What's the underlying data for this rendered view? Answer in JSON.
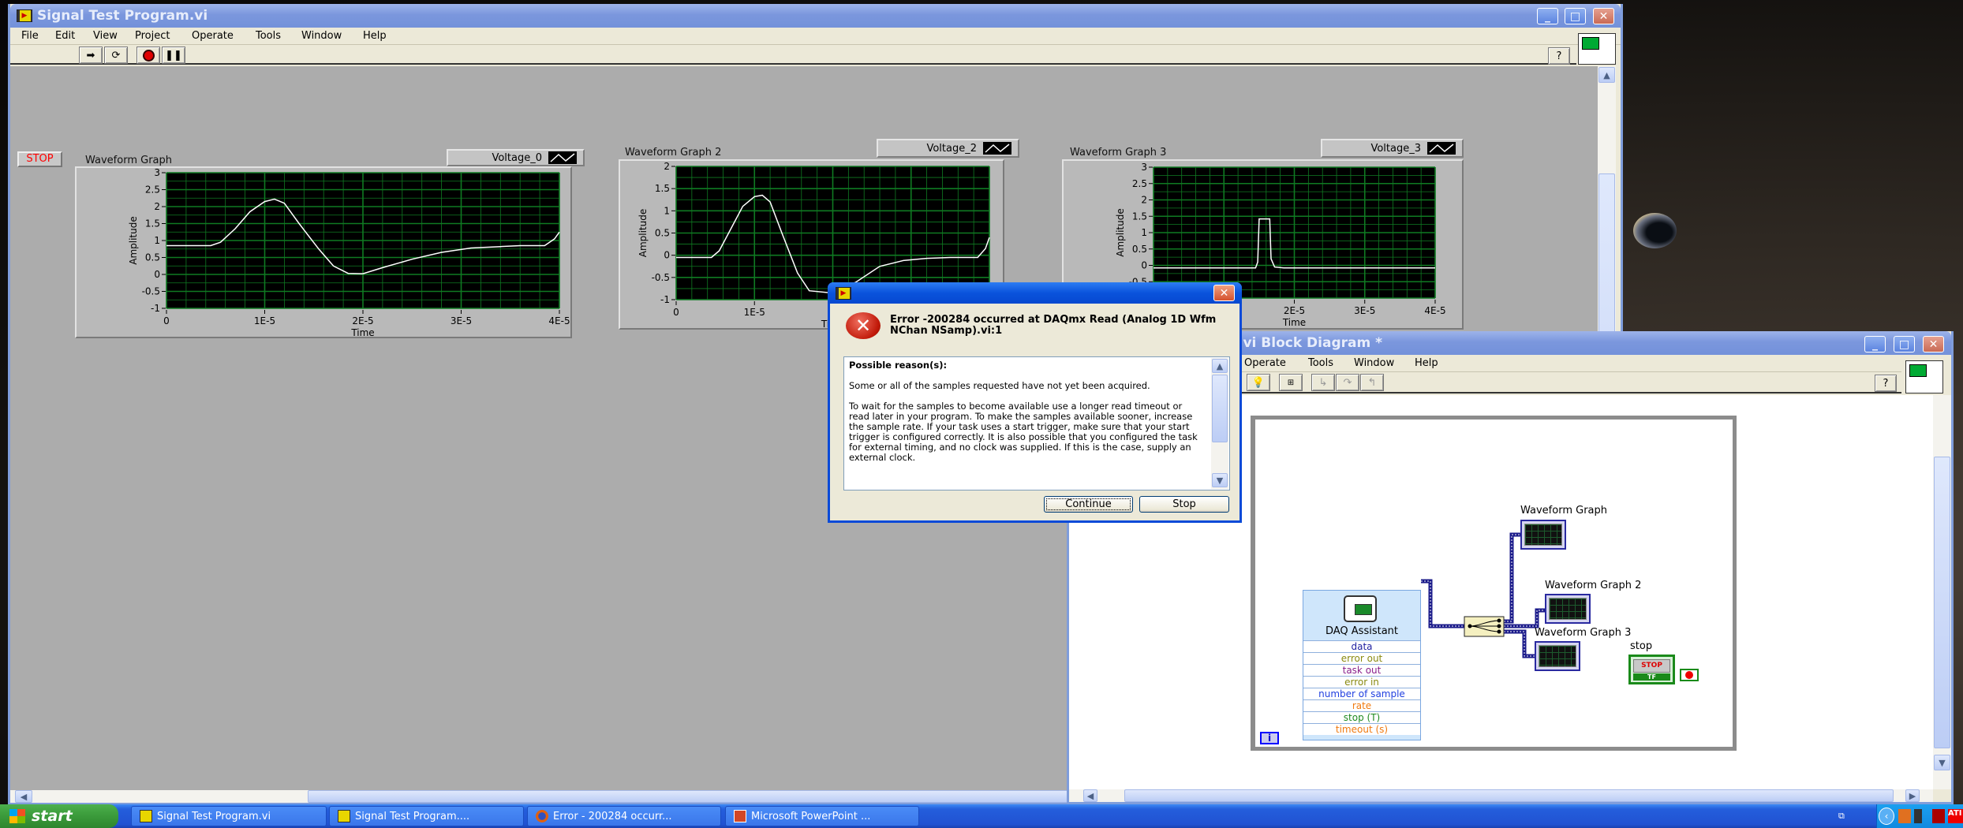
{
  "front_panel": {
    "title": "Signal Test Program.vi",
    "menu": [
      "File",
      "Edit",
      "View",
      "Project",
      "Operate",
      "Tools",
      "Window",
      "Help"
    ],
    "toolbar": {
      "run": "run-arrow",
      "run_continuously": "run-continuously",
      "abort": "abort-execution",
      "pause": "pause"
    },
    "stop_button": "STOP",
    "graphs": [
      {
        "label": "Waveform Graph",
        "legend": "Voltage_0"
      },
      {
        "label": "Waveform Graph 2",
        "legend": "Voltage_2"
      },
      {
        "label": "Waveform Graph 3",
        "legend": "Voltage_3"
      }
    ]
  },
  "chart_data": [
    {
      "type": "line",
      "title": "Waveform Graph",
      "xlabel": "Time",
      "ylabel": "Amplitude",
      "series": [
        {
          "name": "Voltage_0",
          "color": "#ffffff",
          "x": [
            0,
            4.5e-06,
            5.5e-06,
            7e-06,
            8.5e-06,
            1e-05,
            1.1e-05,
            1.2e-05,
            1.35e-05,
            1.55e-05,
            1.7e-05,
            1.85e-05,
            2e-05,
            2.2e-05,
            2.5e-05,
            2.8e-05,
            3.1e-05,
            3.4e-05,
            3.6e-05,
            3.85e-05,
            3.95e-05,
            4e-05
          ],
          "y": [
            0.85,
            0.85,
            0.95,
            1.35,
            1.85,
            2.15,
            2.22,
            2.1,
            1.5,
            0.75,
            0.25,
            0.03,
            0.02,
            0.2,
            0.45,
            0.65,
            0.78,
            0.82,
            0.85,
            0.85,
            1.05,
            1.25
          ]
        }
      ],
      "xlim": [
        0,
        4e-05
      ],
      "ylim": [
        -1,
        3
      ],
      "xticks": [
        {
          "v": 0,
          "label": "0"
        },
        {
          "v": 1e-05,
          "label": "1E-5"
        },
        {
          "v": 2e-05,
          "label": "2E-5"
        },
        {
          "v": 3e-05,
          "label": "3E-5"
        },
        {
          "v": 4e-05,
          "label": "4E-5"
        }
      ],
      "yticks": [
        {
          "v": 3,
          "label": "3"
        },
        {
          "v": 2.5,
          "label": "2.5"
        },
        {
          "v": 2,
          "label": "2"
        },
        {
          "v": 1.5,
          "label": "1.5"
        },
        {
          "v": 1,
          "label": "1"
        },
        {
          "v": 0.5,
          "label": "0.5"
        },
        {
          "v": 0,
          "label": "0"
        },
        {
          "v": -0.5,
          "label": "-0.5"
        },
        {
          "v": -1,
          "label": "-1"
        }
      ],
      "grid": true,
      "background": "#000000",
      "grid_color": "#0f7a22"
    },
    {
      "type": "line",
      "title": "Waveform Graph 2",
      "xlabel": "Time",
      "ylabel": "Amplitude",
      "series": [
        {
          "name": "Voltage_2",
          "color": "#ffffff",
          "x": [
            0,
            4.5e-06,
            5.5e-06,
            7e-06,
            8.5e-06,
            1e-05,
            1.1e-05,
            1.2e-05,
            1.35e-05,
            1.55e-05,
            1.7e-05,
            2e-05,
            2.3e-05,
            2.6e-05,
            2.9e-05,
            3.2e-05,
            3.5e-05,
            3.85e-05,
            3.95e-05,
            4e-05
          ],
          "y": [
            -0.05,
            -0.05,
            0.1,
            0.6,
            1.1,
            1.32,
            1.35,
            1.2,
            0.5,
            -0.4,
            -0.8,
            -0.85,
            -0.6,
            -0.25,
            -0.12,
            -0.07,
            -0.05,
            -0.05,
            0.15,
            0.4
          ]
        }
      ],
      "xlim": [
        0,
        4e-05
      ],
      "ylim": [
        -1,
        2
      ],
      "xticks": [
        {
          "v": 0,
          "label": "0"
        },
        {
          "v": 1e-05,
          "label": "1E-5"
        }
      ],
      "yticks": [
        {
          "v": 2,
          "label": "2"
        },
        {
          "v": 1.5,
          "label": "1.5"
        },
        {
          "v": 1,
          "label": "1"
        },
        {
          "v": 0.5,
          "label": "0.5"
        },
        {
          "v": 0,
          "label": "0"
        },
        {
          "v": -0.5,
          "label": "-0.5"
        },
        {
          "v": -1,
          "label": "-1"
        }
      ],
      "grid": true,
      "background": "#000000",
      "grid_color": "#0f7a22"
    },
    {
      "type": "line",
      "title": "Waveform Graph 3",
      "xlabel": "Time",
      "ylabel": "Amplitude",
      "series": [
        {
          "name": "Voltage_3",
          "color": "#ffffff",
          "x": [
            0,
            1.45e-05,
            1.48e-05,
            1.5e-05,
            1.65e-05,
            1.67e-05,
            1.72e-05,
            1.85e-05,
            4e-05
          ],
          "y": [
            -0.08,
            -0.08,
            0.1,
            1.42,
            1.42,
            0.2,
            -0.05,
            -0.08,
            -0.08
          ]
        }
      ],
      "xlim": [
        0,
        4e-05
      ],
      "ylim": [
        -1,
        3
      ],
      "xticks": [
        {
          "v": 2e-05,
          "label": "2E-5"
        },
        {
          "v": 3e-05,
          "label": "3E-5"
        },
        {
          "v": 4e-05,
          "label": "4E-5"
        }
      ],
      "yticks": [
        {
          "v": 3,
          "label": "3"
        },
        {
          "v": 2.5,
          "label": "2.5"
        },
        {
          "v": 2,
          "label": "2"
        },
        {
          "v": 1.5,
          "label": "1.5"
        },
        {
          "v": 1,
          "label": "1"
        },
        {
          "v": 0.5,
          "label": "0.5"
        },
        {
          "v": 0,
          "label": "0"
        },
        {
          "v": -0.5,
          "label": "-0.5"
        }
      ],
      "grid": true,
      "background": "#000000",
      "grid_color": "#0f7a22"
    }
  ],
  "dialog": {
    "heading": "Error -200284 occurred at DAQmx Read (Analog 1D Wfm NChan NSamp).vi:1",
    "reason_title": "Possible reason(s):",
    "paragraph1": "Some or all of the samples requested have not yet been acquired.",
    "paragraph2": "To wait for the samples to become available use a longer read timeout or read later in your program. To make the samples available sooner, increase the sample rate. If your task uses a start trigger,  make sure that your start trigger is configured correctly. It is also possible that you configured the task for external timing, and no clock was supplied. If this is the case, supply an external clock.",
    "continue": "Continue",
    "stop": "Stop"
  },
  "block_diagram": {
    "title": ".vi Block Diagram *",
    "menu": [
      "Operate",
      "Tools",
      "Window",
      "Help"
    ],
    "daq_assistant": {
      "title": "DAQ Assistant",
      "terminals": [
        {
          "label": "data",
          "color": "#1f1fa0"
        },
        {
          "label": "error out",
          "color": "#8a8a10"
        },
        {
          "label": "task out",
          "color": "#8a1f8a"
        },
        {
          "label": "error in",
          "color": "#8a8a10"
        },
        {
          "label": "number of sample",
          "color": "#1f3fe0"
        },
        {
          "label": "rate",
          "color": "#f07a10"
        },
        {
          "label": "stop (T)",
          "color": "#1f8a1f"
        },
        {
          "label": "timeout (s)",
          "color": "#f07a10"
        }
      ]
    },
    "terminals": [
      "Waveform Graph",
      "Waveform Graph 2",
      "Waveform Graph 3"
    ],
    "stop_label": "stop",
    "stop_button": "STOP",
    "stop_tf": "TF",
    "info": "i"
  },
  "taskbar": {
    "start": "start",
    "items": [
      {
        "label": "Signal Test Program.vi",
        "icon": "labview-icon"
      },
      {
        "label": "Signal Test Program....",
        "icon": "labview-icon"
      },
      {
        "label": "Error - 200284 occurr...",
        "icon": "firefox-icon"
      },
      {
        "label": "Microsoft PowerPoint ...",
        "icon": "powerpoint-icon"
      }
    ]
  },
  "colors": {
    "title_active": "#0a53dc",
    "title_inactive": "#7b97dd",
    "panel_bg": "#acacac",
    "plot_bg": "#000000",
    "grid": "#0f7a22",
    "wire": "#1a1a8a"
  }
}
